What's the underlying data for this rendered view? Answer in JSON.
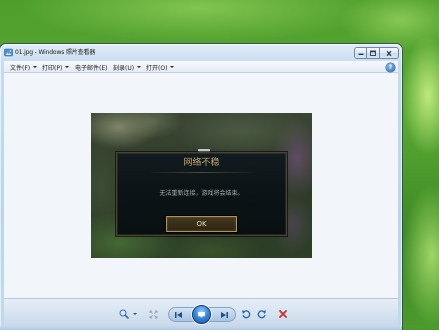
{
  "window": {
    "title": "01.jpg - Windows 照片查看器",
    "app_icon": "photo-viewer-icon",
    "controls": [
      "minimize-icon",
      "maximize-icon",
      "close-icon"
    ]
  },
  "menu": {
    "items": [
      {
        "label": "文件(F)",
        "has_dropdown": true
      },
      {
        "label": "打印(P)",
        "has_dropdown": true
      },
      {
        "label": "电子邮件(E)",
        "has_dropdown": false
      },
      {
        "label": "刻录(U)",
        "has_dropdown": true
      },
      {
        "label": "打开(O)",
        "has_dropdown": true
      }
    ],
    "help": {
      "label": "?",
      "icon": "help-icon"
    }
  },
  "photo": {
    "dialog": {
      "title": "网络不稳",
      "message": "无法重新连接，游戏将会结束。",
      "button_label": "OK"
    }
  },
  "toolbar": {
    "icons": [
      "zoom-icon",
      "actual-size-icon",
      "previous-icon",
      "slideshow-icon",
      "next-icon",
      "rotate-counterclockwise-icon",
      "rotate-clockwise-icon",
      "delete-icon"
    ]
  },
  "colors": {
    "desktop_green": "#4f9e2c",
    "window_frame": "#c6dbef",
    "dialog_title": "#c8aa6e",
    "dialog_text": "#a9b0ad",
    "ok_button_border": "#b0925a",
    "delete_red": "#d22b2b",
    "nav_blue": "#2a64a8"
  }
}
